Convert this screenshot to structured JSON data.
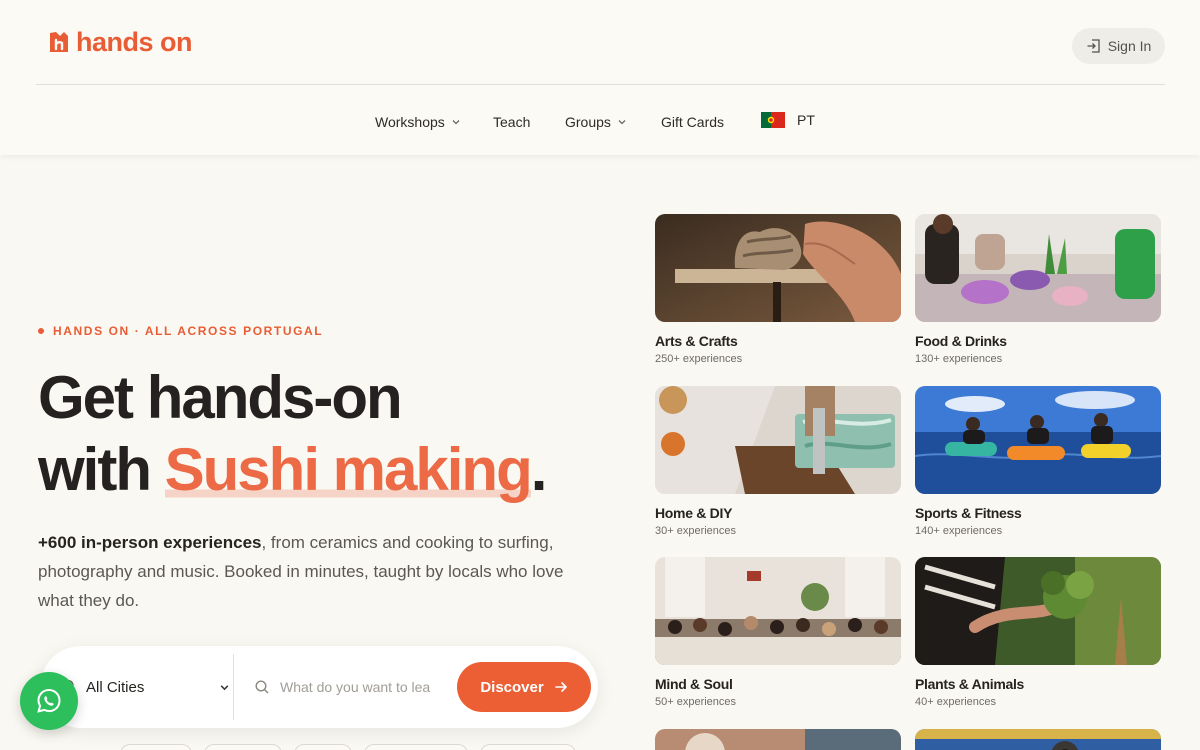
{
  "brand": {
    "name": "hands on",
    "color": "#e85d35"
  },
  "header": {
    "signin_label": "Sign In",
    "nav": {
      "workshops": "Workshops",
      "teach": "Teach",
      "groups": "Groups",
      "gift_cards": "Gift Cards",
      "language": "PT"
    }
  },
  "hero": {
    "eyebrow": "HANDS ON · ALL ACROSS PORTUGAL",
    "title_line1": "Get hands-on",
    "title_with": "with ",
    "title_accent": "Sushi making",
    "title_period": ".",
    "desc_strong": "+600 in-person experiences",
    "desc_rest": ", from ceramics and cooking to surfing, photography and music. Booked in minutes, taught by locals who love what they do."
  },
  "search": {
    "city_value": "All Cities",
    "placeholder": "What do you want to learn?",
    "button_label": "Discover"
  },
  "categories": [
    {
      "title": "Arts & Crafts",
      "count": "250+ experiences"
    },
    {
      "title": "Food & Drinks",
      "count": "130+ experiences"
    },
    {
      "title": "Home & DIY",
      "count": "30+ experiences"
    },
    {
      "title": "Sports & Fitness",
      "count": "140+ experiences"
    },
    {
      "title": "Mind & Soul",
      "count": "50+ experiences"
    },
    {
      "title": "Plants & Animals",
      "count": "40+ experiences"
    }
  ],
  "colors": {
    "accent": "#ec5f35",
    "whatsapp": "#2dbf5c",
    "background": "#faf8f2"
  }
}
